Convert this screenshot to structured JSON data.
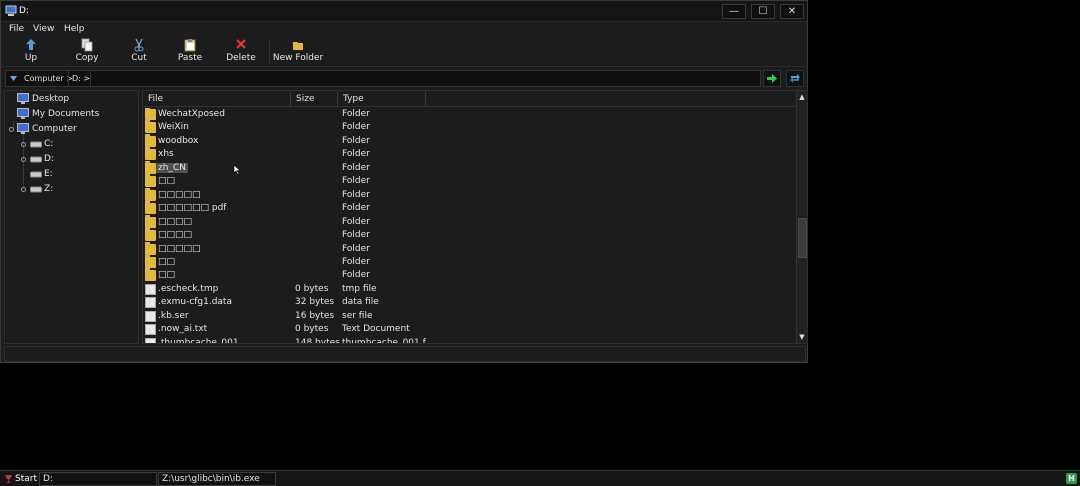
{
  "window": {
    "title": "D:",
    "controls": {
      "minimize": "—",
      "maximize": "☐",
      "close": "✕"
    }
  },
  "menu": [
    "File",
    "View",
    "Help"
  ],
  "toolbar": {
    "up": "Up",
    "copy": "Copy",
    "cut": "Cut",
    "paste": "Paste",
    "delete": "Delete",
    "new_folder": "New Folder"
  },
  "address": {
    "crumbs": [
      "Computer >",
      "D: >"
    ]
  },
  "tree": {
    "items": [
      {
        "label": "Desktop",
        "icon": "desktop-icon"
      },
      {
        "label": "My Documents",
        "icon": "documents-icon"
      },
      {
        "label": "Computer",
        "icon": "computer-icon"
      },
      {
        "label": "C:",
        "icon": "drive-icon"
      },
      {
        "label": "D:",
        "icon": "drive-icon"
      },
      {
        "label": "E:",
        "icon": "drive-icon"
      },
      {
        "label": "Z:",
        "icon": "drive-icon"
      }
    ]
  },
  "columns": {
    "file": "File",
    "size": "Size",
    "type": "Type"
  },
  "files": [
    {
      "name": "WechatXposed",
      "size": "",
      "type": "Folder",
      "kind": "folder"
    },
    {
      "name": "WeiXin",
      "size": "",
      "type": "Folder",
      "kind": "folder"
    },
    {
      "name": "woodbox",
      "size": "",
      "type": "Folder",
      "kind": "folder"
    },
    {
      "name": "xhs",
      "size": "",
      "type": "Folder",
      "kind": "folder"
    },
    {
      "name": "zh_CN",
      "size": "",
      "type": "Folder",
      "kind": "folder",
      "selected": true
    },
    {
      "name": "□□",
      "size": "",
      "type": "Folder",
      "kind": "folder"
    },
    {
      "name": "□□□□□",
      "size": "",
      "type": "Folder",
      "kind": "folder"
    },
    {
      "name": "□□□□□□ pdf",
      "size": "",
      "type": "Folder",
      "kind": "folder"
    },
    {
      "name": "□□□□",
      "size": "",
      "type": "Folder",
      "kind": "folder"
    },
    {
      "name": "□□□□",
      "size": "",
      "type": "Folder",
      "kind": "folder"
    },
    {
      "name": "□□□□□",
      "size": "",
      "type": "Folder",
      "kind": "folder"
    },
    {
      "name": "□□",
      "size": "",
      "type": "Folder",
      "kind": "folder"
    },
    {
      "name": "□□",
      "size": "",
      "type": "Folder",
      "kind": "folder"
    },
    {
      "name": ".escheck.tmp",
      "size": "0 bytes",
      "type": "tmp file",
      "kind": "file"
    },
    {
      "name": ".exmu-cfg1.data",
      "size": "32 bytes",
      "type": "data file",
      "kind": "file"
    },
    {
      "name": ".kb.ser",
      "size": "16 bytes",
      "type": "ser file",
      "kind": "file"
    },
    {
      "name": ".now_ai.txt",
      "size": "0 bytes",
      "type": "Text Document",
      "kind": "file"
    },
    {
      "name": ".thumbcache_001",
      "size": "148 bytes",
      "type": "thumbcache_001 f",
      "kind": "file"
    }
  ],
  "taskbar": {
    "start": "Start",
    "task1": "D:",
    "task2": "Z:\\usr\\glibc\\bin\\ib.exe",
    "tray": "H"
  },
  "colors": {
    "folder": "#e2b93b",
    "go_arrow": "#2ecc40",
    "delete_x": "#e53935",
    "up_arrow": "#4aa3df",
    "tray": "#2ea043"
  }
}
